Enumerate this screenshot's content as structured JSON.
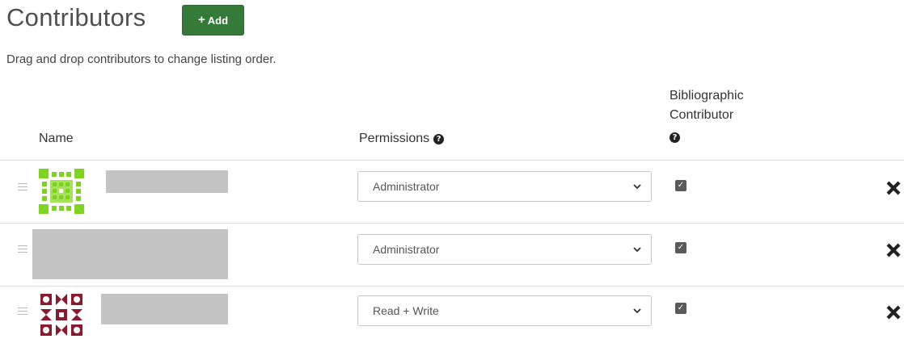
{
  "header": {
    "title": "Contributors",
    "add_label": "Add"
  },
  "instructions": "Drag and drop contributors to change listing order.",
  "table": {
    "columns": {
      "name": "Name",
      "permissions": "Permissions",
      "bibliographic_line1": "Bibliographic",
      "bibliographic_line2": "Contributor"
    },
    "rows": [
      {
        "permission": "Administrator",
        "bibliographic": true
      },
      {
        "permission": "Administrator",
        "bibliographic": true
      },
      {
        "permission": "Read + Write",
        "bibliographic": true
      }
    ]
  },
  "icons": {
    "add": "plus-icon",
    "help": "question-circle-icon",
    "drag": "drag-handle-icon",
    "dropdown": "chevron-down-icon",
    "checkbox": "checkbox-checked-icon",
    "remove": "close-icon"
  },
  "colors": {
    "add_button": "#357a38",
    "avatar1": "#7ed321",
    "avatar3": "#8b1a2e",
    "redacted": "#c4c4c4"
  }
}
